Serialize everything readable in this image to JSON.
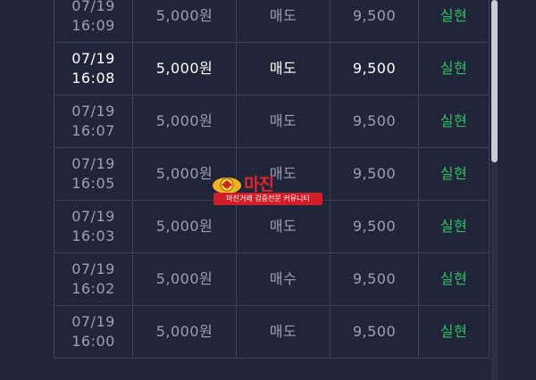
{
  "rows": [
    {
      "date": "07/19",
      "time": "16:09",
      "amount": "5,000원",
      "type": "매도",
      "price": "9,500",
      "status": "실현"
    },
    {
      "date": "07/19",
      "time": "16:08",
      "amount": "5,000원",
      "type": "매도",
      "price": "9,500",
      "status": "실현"
    },
    {
      "date": "07/19",
      "time": "16:07",
      "amount": "5,000원",
      "type": "매도",
      "price": "9,500",
      "status": "실현"
    },
    {
      "date": "07/19",
      "time": "16:05",
      "amount": "5,000원",
      "type": "매도",
      "price": "9,500",
      "status": "실현"
    },
    {
      "date": "07/19",
      "time": "16:03",
      "amount": "5,000원",
      "type": "매도",
      "price": "9,500",
      "status": "실현"
    },
    {
      "date": "07/19",
      "time": "16:02",
      "amount": "5,000원",
      "type": "매수",
      "price": "9,500",
      "status": "실현"
    },
    {
      "date": "07/19",
      "time": "16:00",
      "amount": "5,000원",
      "type": "매도",
      "price": "9,500",
      "status": "실현"
    }
  ],
  "highlighted_row": 1,
  "watermark": {
    "logo_text": "마진",
    "subtitle": "마진거래 검증전문 커뮤니티"
  },
  "colors": {
    "background": "#21253a",
    "status_green": "#2fbf63",
    "watermark_red": "#e0262b"
  }
}
